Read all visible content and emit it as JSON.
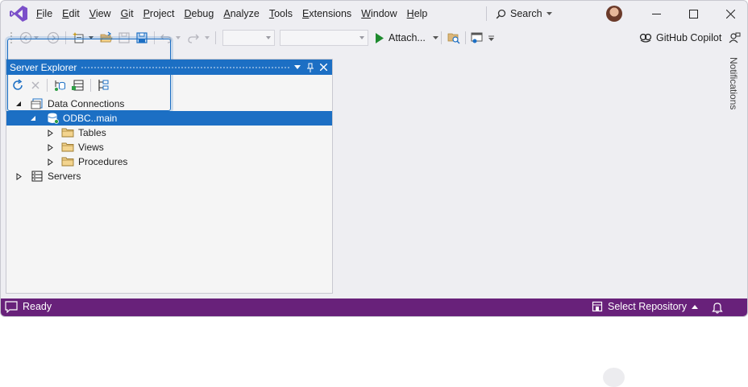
{
  "menubar": {
    "items": [
      "File",
      "Edit",
      "View",
      "Git",
      "Project",
      "Debug",
      "Analyze",
      "Tools",
      "Extensions",
      "Window",
      "Help"
    ],
    "search_label": "Search"
  },
  "toolbar": {
    "attach_label": "Attach...",
    "copilot_label": "GitHub Copilot"
  },
  "server_explorer": {
    "title": "Server Explorer",
    "tree": {
      "data_connections": "Data Connections",
      "connection": "ODBC..main",
      "tables": "Tables",
      "views": "Views",
      "procedures": "Procedures",
      "servers": "Servers"
    }
  },
  "side_tabs": {
    "notifications": "Notifications"
  },
  "statusbar": {
    "ready": "Ready",
    "select_repository": "Select Repository"
  },
  "colors": {
    "accent": "#1c6fc4",
    "statusbar": "#68217a",
    "vs_logo": "#7b4fc9"
  }
}
